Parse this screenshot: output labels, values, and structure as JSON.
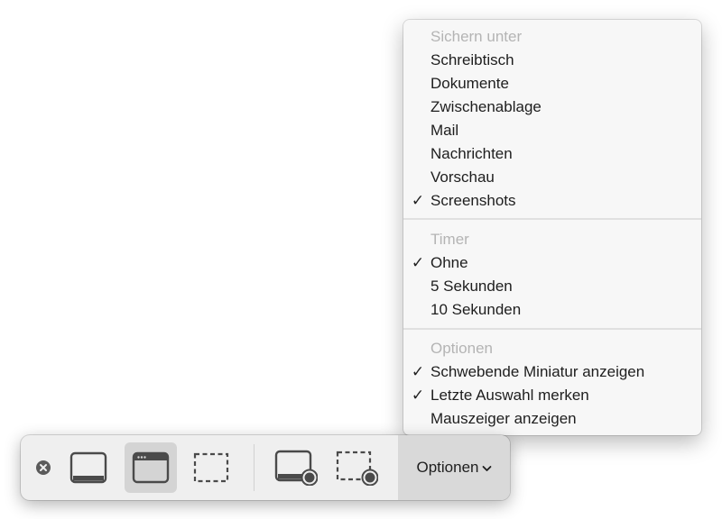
{
  "menu": {
    "sections": [
      {
        "header": "Sichern unter",
        "items": [
          {
            "label": "Schreibtisch",
            "checked": false
          },
          {
            "label": "Dokumente",
            "checked": false
          },
          {
            "label": "Zwischenablage",
            "checked": false
          },
          {
            "label": "Mail",
            "checked": false
          },
          {
            "label": "Nachrichten",
            "checked": false
          },
          {
            "label": "Vorschau",
            "checked": false
          },
          {
            "label": "Screenshots",
            "checked": true
          }
        ]
      },
      {
        "header": "Timer",
        "items": [
          {
            "label": "Ohne",
            "checked": true
          },
          {
            "label": "5 Sekunden",
            "checked": false
          },
          {
            "label": "10 Sekunden",
            "checked": false
          }
        ]
      },
      {
        "header": "Optionen",
        "items": [
          {
            "label": "Schwebende Miniatur anzeigen",
            "checked": true
          },
          {
            "label": "Letzte Auswahl merken",
            "checked": true
          },
          {
            "label": "Mauszeiger anzeigen",
            "checked": false
          }
        ]
      }
    ],
    "checkmark": "✓"
  },
  "toolbar": {
    "options_label": "Optionen",
    "options_chevron": "⌄",
    "buttons": [
      {
        "icon": "capture-entire-screen-icon",
        "selected": false
      },
      {
        "icon": "capture-window-icon",
        "selected": true
      },
      {
        "icon": "capture-selection-icon",
        "selected": false
      },
      {
        "icon": "record-entire-screen-icon",
        "selected": false
      },
      {
        "icon": "record-selection-icon",
        "selected": false
      }
    ]
  },
  "colors": {
    "toolbar_bg": "#efefef",
    "selected_bg": "#d4d4d4",
    "options_bg": "#d9d9d9",
    "menu_bg": "#f7f7f7",
    "header_text": "#b4b4b4",
    "item_text": "#1e1e1e"
  }
}
